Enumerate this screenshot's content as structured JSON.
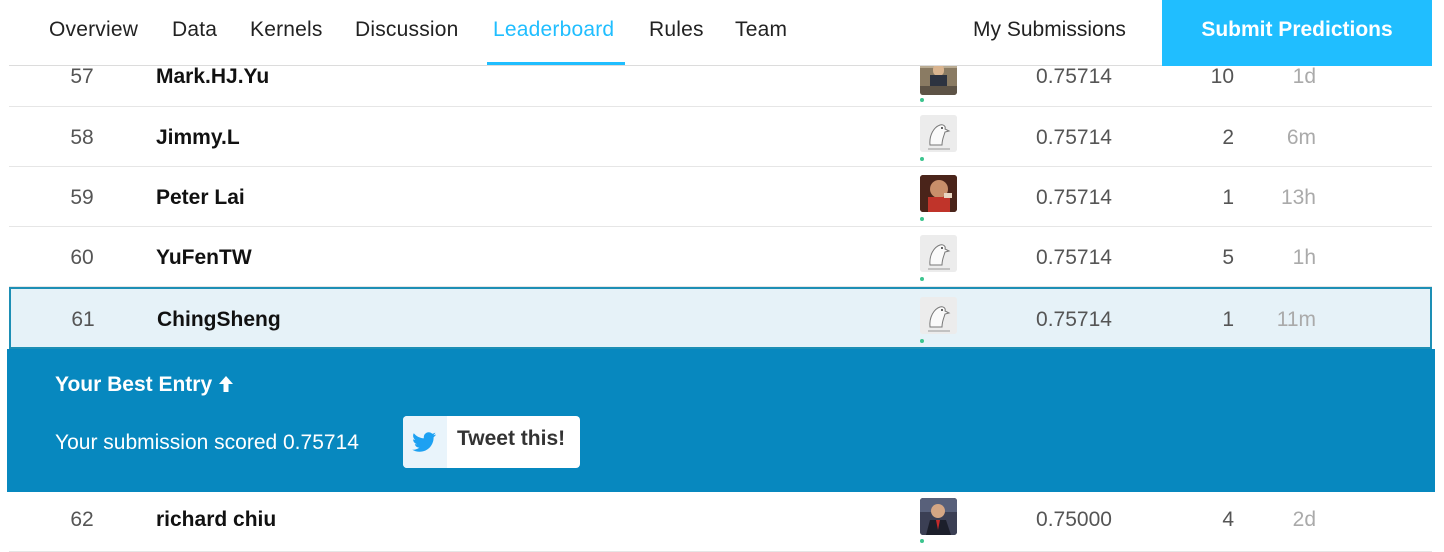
{
  "nav": {
    "tabs": [
      "Overview",
      "Data",
      "Kernels",
      "Discussion",
      "Leaderboard",
      "Rules",
      "Team"
    ],
    "active_tab": "Leaderboard",
    "my_submissions": "My Submissions",
    "submit_button": "Submit Predictions"
  },
  "rows": [
    {
      "rank": "57",
      "name": "Mark.HJ.Yu",
      "avatar": "photo-avatar",
      "score": "0.75714",
      "entries": "10",
      "last": "1d"
    },
    {
      "rank": "58",
      "name": "Jimmy.L",
      "avatar": "goose-avatar",
      "score": "0.75714",
      "entries": "2",
      "last": "6m"
    },
    {
      "rank": "59",
      "name": "Peter Lai",
      "avatar": "photo-avatar",
      "score": "0.75714",
      "entries": "1",
      "last": "13h"
    },
    {
      "rank": "60",
      "name": "YuFenTW",
      "avatar": "goose-avatar",
      "score": "0.75714",
      "entries": "5",
      "last": "1h"
    },
    {
      "rank": "61",
      "name": "ChingSheng",
      "avatar": "goose-avatar",
      "score": "0.75714",
      "entries": "1",
      "last": "11m"
    }
  ],
  "best_entry": {
    "title": "Your Best Entry",
    "text": "Your submission scored 0.75714",
    "tweet_label": "Tweet this!"
  },
  "after_row": {
    "rank": "62",
    "name": "richard chiu",
    "avatar": "photo-avatar",
    "score": "0.75000",
    "entries": "4",
    "last": "2d"
  },
  "colors": {
    "accent": "#20beff",
    "panel": "#0788bf",
    "highlight_row": "#e6f2f8",
    "online_dot": "#3cc48e"
  }
}
